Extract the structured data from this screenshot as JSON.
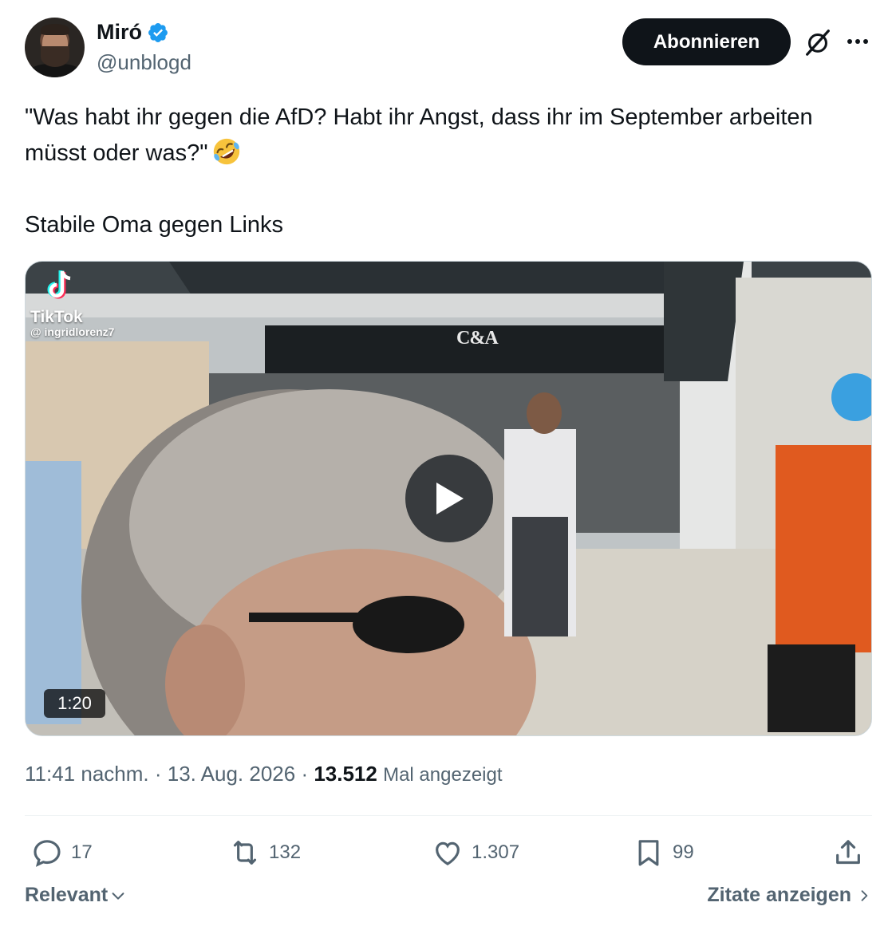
{
  "author": {
    "name": "Miró",
    "handle": "@unblogd",
    "verified": true
  },
  "header": {
    "follow_label": "Abonnieren",
    "icons": [
      "grok-icon",
      "more-icon"
    ]
  },
  "tweet": {
    "line1": "\"Was habt ihr gegen die AfD? Habt ihr Angst, dass ihr im September arbeiten müsst oder was?\"",
    "emoji": "rolling-on-floor-laughing-emoji",
    "line2": "Stabile Oma gegen Links"
  },
  "media": {
    "overlay_brand": "TikTok",
    "overlay_user": "@ ingridlorenz7",
    "store_sign": "C&A",
    "duration": "1:20",
    "play_icon": "play-icon"
  },
  "meta": {
    "time": "11:41 nachm.",
    "separator": " · ",
    "date": "13. Aug. 2026",
    "views_count": "13.512",
    "views_label": "Mal angezeigt"
  },
  "actions": {
    "replies": "17",
    "reposts": "132",
    "likes": "1.307",
    "bookmarks": "99"
  },
  "footer": {
    "sort_label": "Relevant",
    "quotes_label": "Zitate anzeigen"
  },
  "colors": {
    "text": "#0f1419",
    "secondary": "#536471",
    "verified": "#1d9bf0",
    "button": "#0f1419"
  }
}
